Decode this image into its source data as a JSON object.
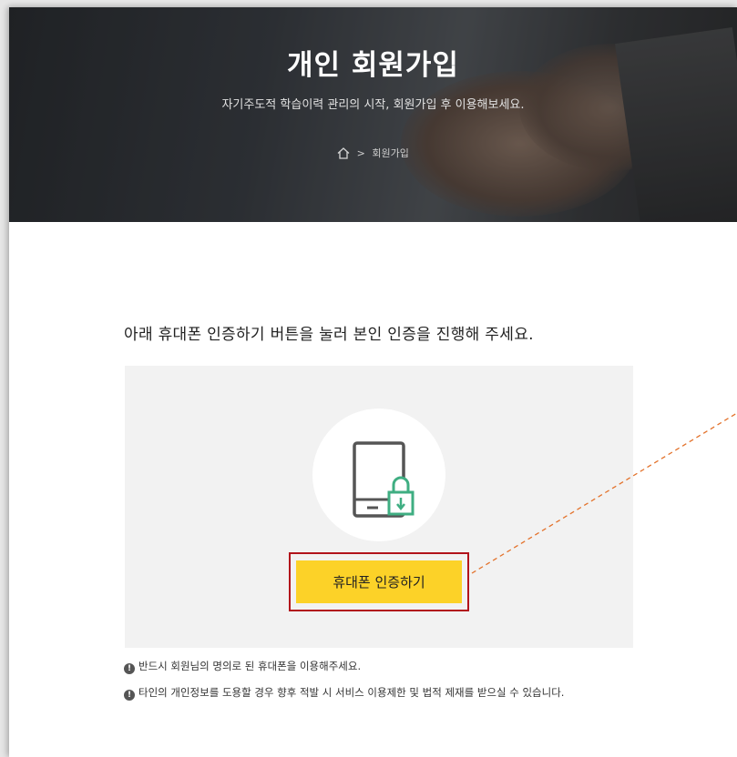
{
  "hero": {
    "title": "개인 회원가입",
    "subtitle": "자기주도적 학습이력 관리의 시작, 회원가입 후 이용해보세요.",
    "breadcrumb": {
      "separator": ">",
      "current": "회원가입",
      "home_icon": "home-icon"
    }
  },
  "main": {
    "instruction": "아래 휴대폰 인증하기 버튼을 눌러 본인 인증을 진행해 주세요.",
    "auth": {
      "icon": "phone-lock-icon",
      "button_label": "휴대폰 인증하기"
    },
    "notices": [
      {
        "icon": "exclamation-icon",
        "text": "반드시 회원님의 명의로 된 휴대폰을 이용해주세요."
      },
      {
        "icon": "exclamation-icon",
        "text": "타인의 개인정보를 도용할 경우 향후 적발 시 서비스 이용제한 및 법적 제재를 받으실 수 있습니다."
      }
    ]
  },
  "colors": {
    "button_bg": "#fcd228",
    "highlight_border": "#b2141c",
    "lock_green": "#3fae82",
    "annotation_line": "#e3722b",
    "panel_bg": "#f2f2f2"
  }
}
